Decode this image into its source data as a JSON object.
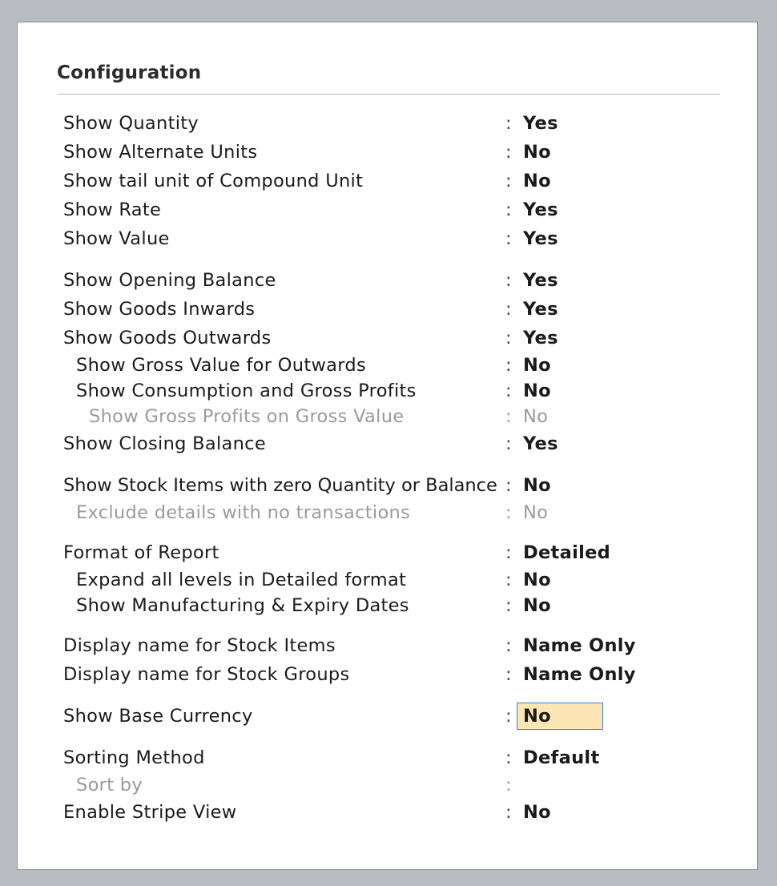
{
  "panel": {
    "title": "Configuration"
  },
  "rows": [
    {
      "label": "Show Quantity",
      "colon": ":",
      "value": "Yes"
    },
    {
      "label": "Show Alternate Units",
      "colon": ":",
      "value": "No"
    },
    {
      "label": "Show tail unit of Compound Unit",
      "colon": ":",
      "value": "No"
    },
    {
      "label": "Show Rate",
      "colon": ":",
      "value": "Yes"
    },
    {
      "label": "Show Value",
      "colon": ":",
      "value": "Yes"
    },
    {
      "label": "Show Opening Balance",
      "colon": ":",
      "value": "Yes"
    },
    {
      "label": "Show Goods Inwards",
      "colon": ":",
      "value": "Yes"
    },
    {
      "label": "Show Goods Outwards",
      "colon": ":",
      "value": "Yes"
    },
    {
      "label": "Show Gross Value for Outwards",
      "colon": ":",
      "value": "No"
    },
    {
      "label": "Show Consumption and Gross Profits",
      "colon": ":",
      "value": "No"
    },
    {
      "label": "Show Gross Profits on Gross Value",
      "colon": ":",
      "value": "No"
    },
    {
      "label": "Show Closing Balance",
      "colon": ":",
      "value": "Yes"
    },
    {
      "label": "Show Stock Items with zero Quantity or Balance",
      "colon": ":",
      "value": "No"
    },
    {
      "label": "Exclude details with no transactions",
      "colon": ":",
      "value": "No"
    },
    {
      "label": "Format of Report",
      "colon": ":",
      "value": "Detailed"
    },
    {
      "label": "Expand all levels in Detailed format",
      "colon": ":",
      "value": "No"
    },
    {
      "label": "Show Manufacturing & Expiry Dates",
      "colon": ":",
      "value": "No"
    },
    {
      "label": "Display name for Stock Items",
      "colon": ":",
      "value": "Name Only"
    },
    {
      "label": "Display name for Stock Groups",
      "colon": ":",
      "value": "Name Only"
    },
    {
      "label": "Show Base Currency",
      "colon": ":",
      "value": "No"
    },
    {
      "label": "Sorting Method",
      "colon": ":",
      "value": "Default"
    },
    {
      "label": "Sort by",
      "colon": ":",
      "value": ""
    },
    {
      "label": "Enable Stripe View",
      "colon": ":",
      "value": "No"
    }
  ],
  "colors": {
    "focus_fill": "#fde6b6",
    "focus_border": "#3f7fc8",
    "disabled_text": "#9a9a9a"
  }
}
